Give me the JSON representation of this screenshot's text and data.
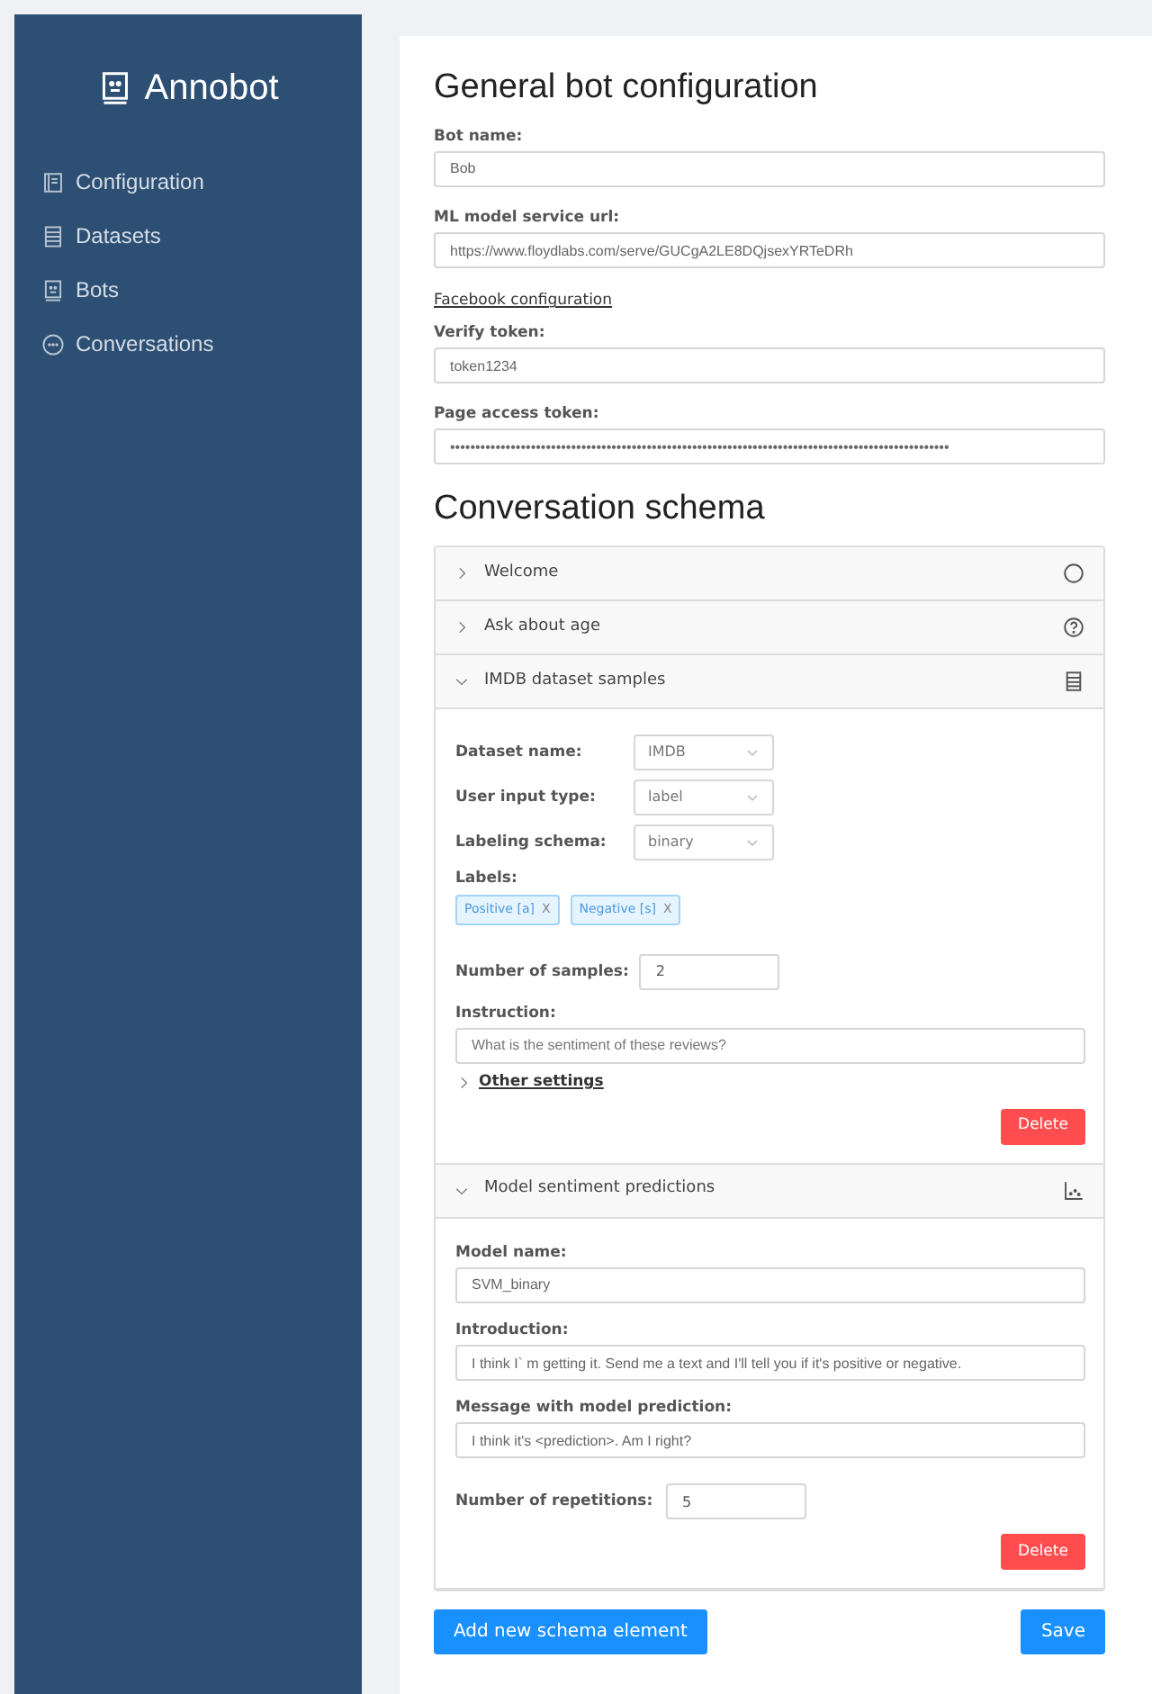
{
  "sidebar": {
    "brand": "Annobot",
    "items": [
      {
        "label": "Configuration",
        "selected": false
      },
      {
        "label": "Datasets",
        "selected": false
      },
      {
        "label": "Bots",
        "selected": false
      },
      {
        "label": "Conversations",
        "selected": false
      }
    ]
  },
  "general": {
    "title": "General bot configuration",
    "fields": [
      {
        "kind": "text",
        "label": "Bot name:",
        "value": "Bob"
      },
      {
        "kind": "text",
        "label": "ML model service url:",
        "value": "https://www.floydlabs.com/serve/GUCgA2LE8DQjsexYRTeDRh"
      },
      {
        "kind": "link",
        "label": "Facebook configuration"
      },
      {
        "kind": "text",
        "label": "Verify token:",
        "value": "token1234"
      },
      {
        "kind": "text",
        "label": "Page access token:",
        "value": "•••••••••••••••••••••••••••••••••••••••••••••••••••••••••••••••••••••••••••••••••••••••••••••••••••"
      }
    ]
  },
  "schema": {
    "title": "Conversation schema",
    "elements": [
      {
        "kind": "message",
        "title": "Welcome",
        "expanded": false
      },
      {
        "kind": "question",
        "title": "Ask about age",
        "expanded": false
      },
      {
        "kind": "dataset",
        "title": "IMDB dataset samples",
        "expanded": true,
        "fields": [
          {
            "kind": "select",
            "label": "Dataset name:",
            "value": "IMDB"
          },
          {
            "kind": "select",
            "label": "User input type:",
            "value": "label"
          },
          {
            "kind": "select",
            "label": "Labeling schema:",
            "value": "binary"
          },
          {
            "kind": "tags",
            "label": "Labels:",
            "tags": [
              {
                "label": "Positive [a]",
                "remove": "X"
              },
              {
                "label": "Negative [s]",
                "remove": "X"
              }
            ]
          },
          {
            "kind": "number",
            "label": "Number of samples:",
            "value": "2"
          },
          {
            "kind": "text",
            "label": "Instruction:",
            "placeholder": "What is the sentiment of these reviews?"
          },
          {
            "kind": "toggle",
            "label": "Other settings",
            "expanded": false
          }
        ],
        "delete": "Delete"
      },
      {
        "kind": "model",
        "title": "Model sentiment predictions",
        "expanded": true,
        "fields": [
          {
            "kind": "text",
            "label": "Model name:",
            "value": "SVM_binary"
          },
          {
            "kind": "text",
            "label": "Introduction:",
            "value": "I think I` m getting it. Send me a text and I'll tell you if it's positive or negative."
          },
          {
            "kind": "text",
            "label": "Message with model prediction:",
            "value": "I think it's <prediction>. Am I right?"
          },
          {
            "kind": "number",
            "label": "Number of repetitions:",
            "value": "5"
          }
        ],
        "delete": "Delete"
      }
    ]
  },
  "buttons": {
    "add": "Add new schema element",
    "save": "Save"
  }
}
